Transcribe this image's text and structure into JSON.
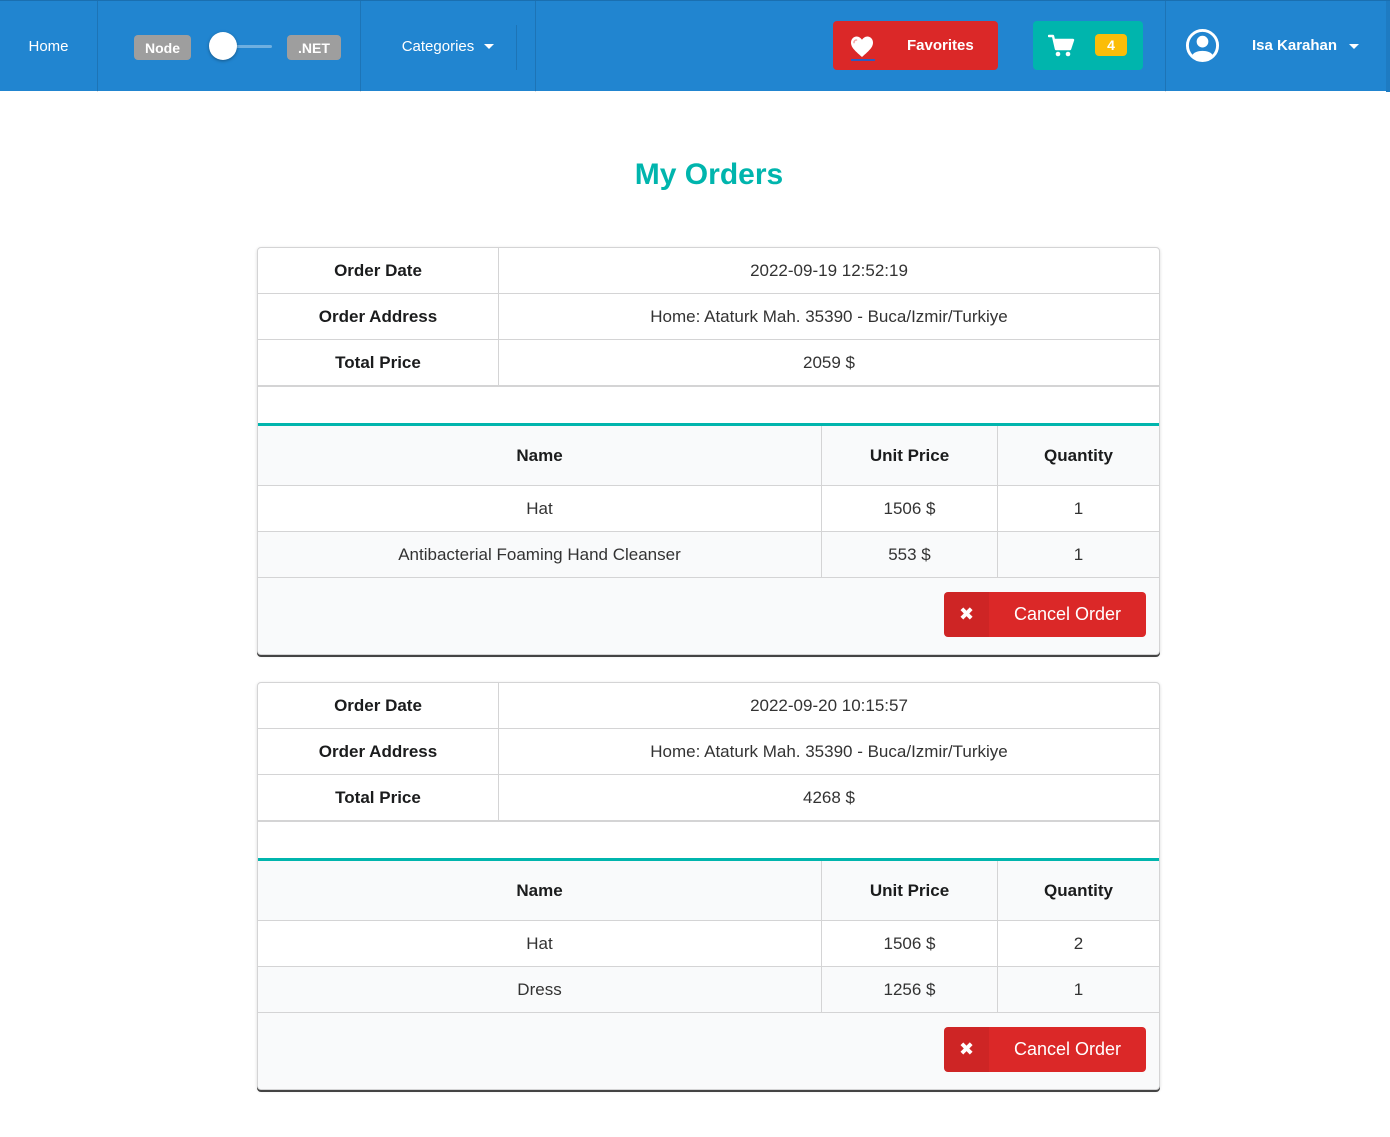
{
  "nav": {
    "home_label": "Home",
    "toggle": {
      "left_label": "Node",
      "right_label": ".NET"
    },
    "categories_label": "Categories",
    "favorites_label": "Favorites",
    "cart_count": "4",
    "user_name": "Isa Karahan"
  },
  "colors": {
    "navbar": "#2185d0",
    "favorites": "#db2828",
    "cart": "#00b5ad",
    "badge": "#fbbd08",
    "title": "#00b5ad",
    "cancel": "#db2828"
  },
  "icons": [
    "heart-icon",
    "cart-icon",
    "user-circle-icon",
    "caret-down-icon",
    "close-icon"
  ],
  "page": {
    "title": "My Orders"
  },
  "labels": {
    "order_date": "Order Date",
    "order_address": "Order Address",
    "total_price": "Total Price",
    "col_name": "Name",
    "col_unit_price": "Unit Price",
    "col_quantity": "Quantity",
    "cancel_order": "Cancel Order",
    "cancel_icon": "✖"
  },
  "orders": [
    {
      "date": "2022-09-19 12:52:19",
      "address": "Home: Ataturk Mah. 35390 - Buca/Izmir/Turkiye",
      "total": "2059 $",
      "items": [
        {
          "name": "Hat",
          "unit_price": "1506 $",
          "quantity": "1"
        },
        {
          "name": "Antibacterial Foaming Hand Cleanser",
          "unit_price": "553 $",
          "quantity": "1"
        }
      ]
    },
    {
      "date": "2022-09-20 10:15:57",
      "address": "Home: Ataturk Mah. 35390 - Buca/Izmir/Turkiye",
      "total": "4268 $",
      "items": [
        {
          "name": "Hat",
          "unit_price": "1506 $",
          "quantity": "2"
        },
        {
          "name": "Dress",
          "unit_price": "1256 $",
          "quantity": "1"
        }
      ]
    }
  ]
}
